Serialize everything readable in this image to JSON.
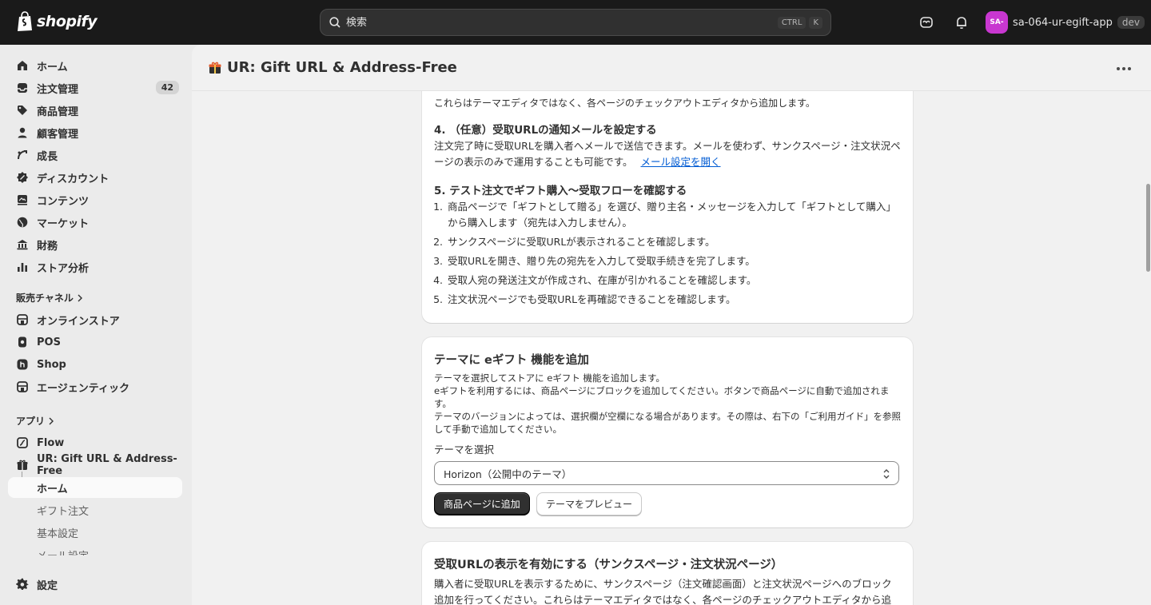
{
  "topbar": {
    "logo_text": "shopify",
    "search_placeholder": "検索",
    "shortcut_ctrl": "CTRL",
    "shortcut_key": "K",
    "avatar_initials": "SA-",
    "store_name": "sa-064-ur-egift-app",
    "env_badge": "dev",
    "avatar_color": "#c837d0"
  },
  "sidebar": {
    "items": [
      {
        "label": "ホーム",
        "icon": "home-icon"
      },
      {
        "label": "注文管理",
        "icon": "inbox-icon",
        "count": "42"
      },
      {
        "label": "商品管理",
        "icon": "tag-icon"
      },
      {
        "label": "顧客管理",
        "icon": "person-icon"
      },
      {
        "label": "成長",
        "icon": "growth-icon"
      },
      {
        "label": "ディスカウント",
        "icon": "discount-icon"
      },
      {
        "label": "コンテンツ",
        "icon": "content-icon"
      },
      {
        "label": "マーケット",
        "icon": "globe-icon"
      },
      {
        "label": "財務",
        "icon": "bank-icon"
      },
      {
        "label": "ストア分析",
        "icon": "chart-icon"
      }
    ],
    "sales_channels_label": "販売チャネル",
    "channels": [
      {
        "label": "オンラインストア",
        "icon": "store-icon"
      },
      {
        "label": "POS",
        "icon": "pos-icon"
      },
      {
        "label": "Shop",
        "icon": "shop-icon"
      },
      {
        "label": "エージェンティック",
        "icon": "agentic-icon"
      }
    ],
    "apps_label": "アプリ",
    "apps": [
      {
        "label": "Flow",
        "icon": "flow-icon"
      },
      {
        "label": "UR: Gift URL & Address-Free",
        "icon": "gift-app-icon"
      }
    ],
    "app_subitems": [
      "ホーム",
      "ギフト注文",
      "基本設定",
      "メール設定"
    ],
    "settings_label": "設定"
  },
  "main": {
    "title": "UR: Gift URL & Address-Free",
    "card1": {
      "intro_text": "これらはテーマエディタではなく、各ページのチェックアウトエディタから追加します。",
      "step4_heading": "4. （任意）受取URLの通知メールを設定する",
      "step4_body": "注文完了時に受取URLを購入者へメールで送信できます。メールを使わず、サンクスページ・注文状況ページの表示のみで運用することも可能です。",
      "step4_link": "メール設定を開く",
      "step5_heading": "5. テスト注文でギフト購入〜受取フローを確認する",
      "step5_items": [
        {
          "num": "1.",
          "text": "商品ページで「ギフトとして贈る」を選び、贈り主名・メッセージを入力して「ギフトとして購入」から購入します（宛先は入力しません）。"
        },
        {
          "num": "2.",
          "text": "サンクスページに受取URLが表示されることを確認します。"
        },
        {
          "num": "3.",
          "text": "受取URLを開き、贈り先の宛先を入力して受取手続きを完了します。"
        },
        {
          "num": "4.",
          "text": "受取人宛の発送注文が作成され、在庫が引かれることを確認します。"
        },
        {
          "num": "5.",
          "text": "注文状況ページでも受取URLを再確認できることを確認します。"
        }
      ]
    },
    "card2": {
      "heading": "テーマに eギフト 機能を追加",
      "desc1": "テーマを選択してストアに eギフト 機能を追加します。",
      "desc2": "eギフトを利用するには、商品ページにブロックを追加してください。ボタンで商品ページに自動で追加されます。",
      "desc3": "テーマのバージョンによっては、選択欄が空欄になる場合があります。その際は、右下の「ご利用ガイド」を参照して手動で追加してください。",
      "select_label": "テーマを選択",
      "select_value": "Horizon（公開中のテーマ）",
      "primary_button": "商品ページに追加",
      "secondary_button": "テーマをプレビュー"
    },
    "card3": {
      "heading": "受取URLの表示を有効にする（サンクスページ・注文状況ページ）",
      "body": "購入者に受取URLを表示するために、サンクスページ（注文確認画面）と注文状況ページへのブロック追加を行ってください。これらはテーマエディタではなく、各ページのチェックアウトエディタから追加します。"
    }
  }
}
